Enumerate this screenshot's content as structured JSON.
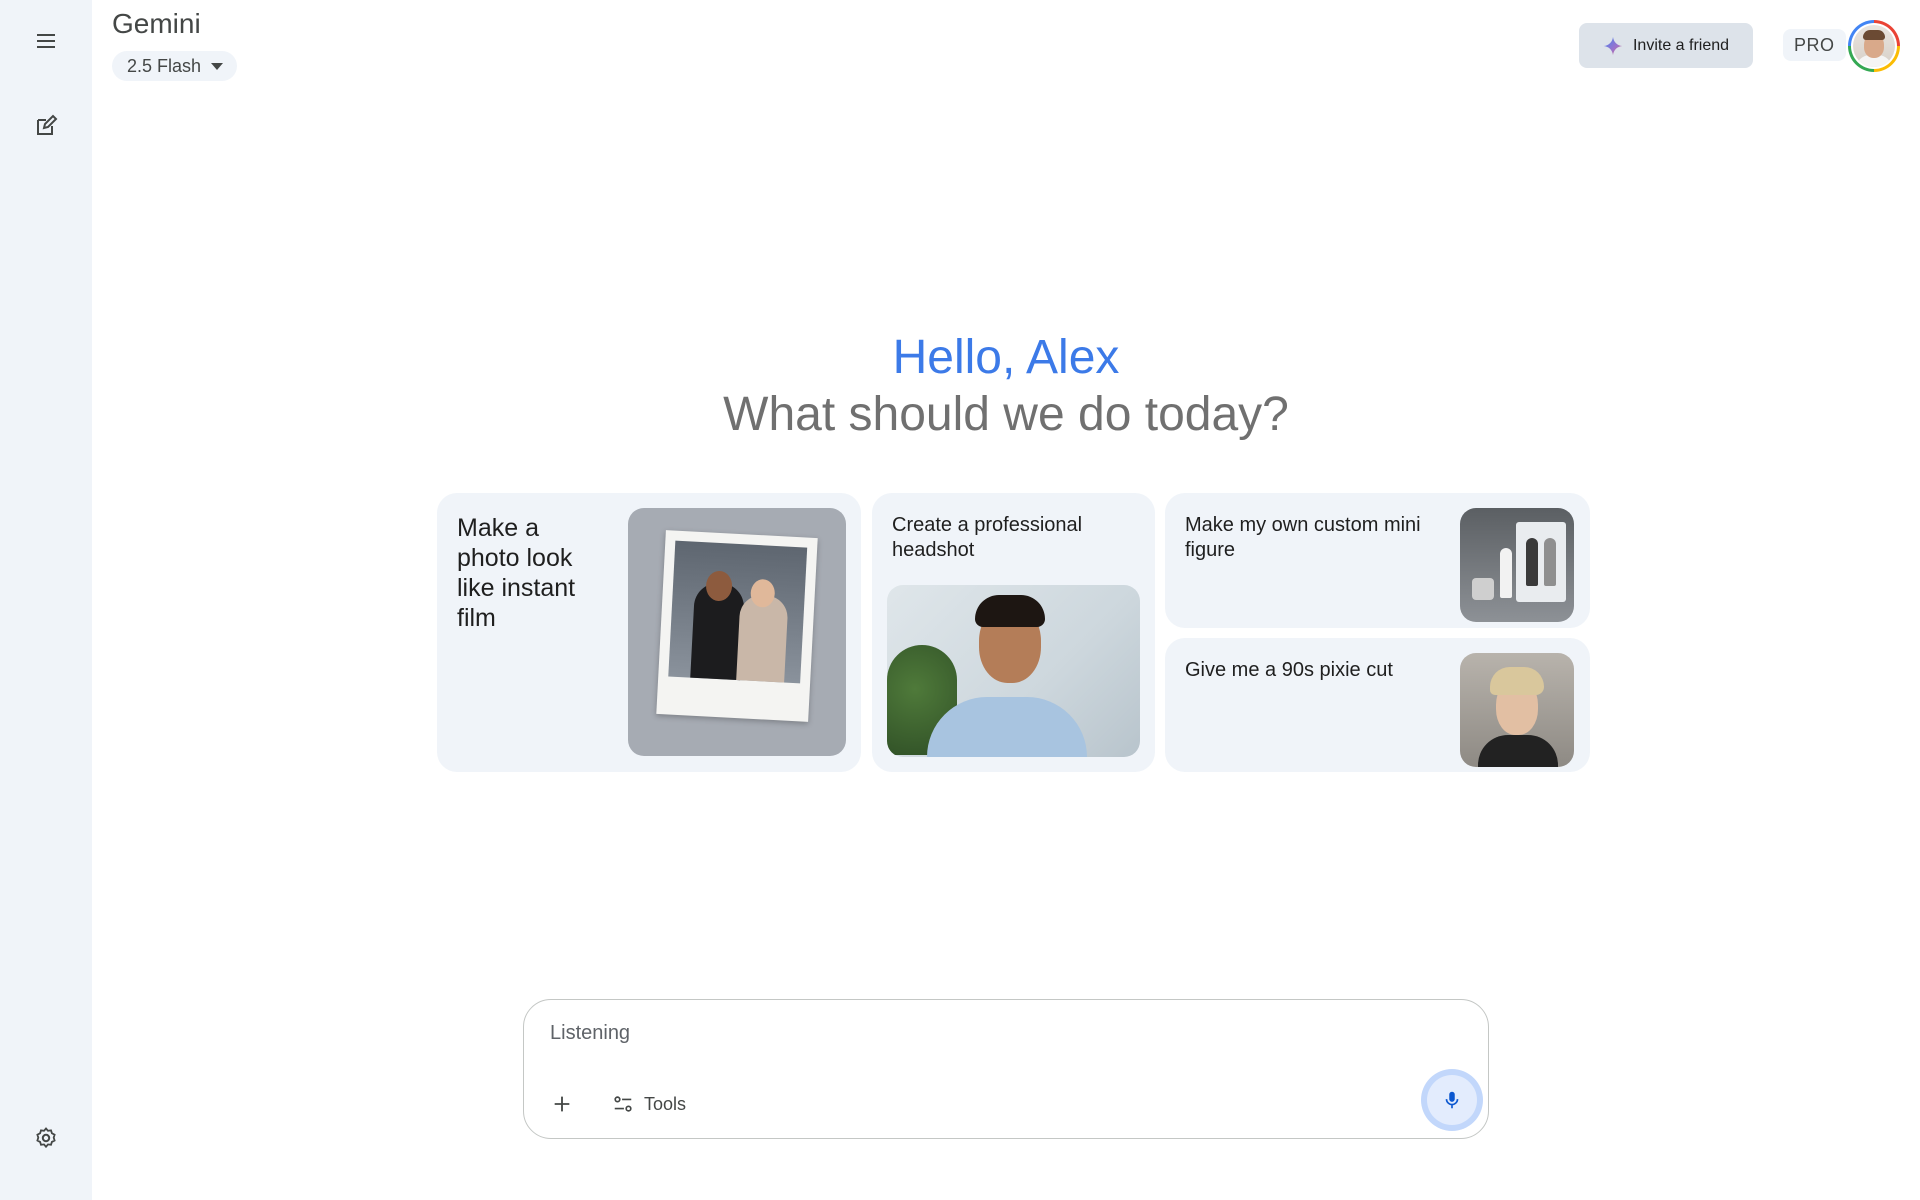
{
  "app": {
    "title": "Gemini",
    "model_label": "2.5 Flash"
  },
  "header": {
    "invite_label": "Invite a friend",
    "plan_badge": "PRO"
  },
  "rail": {
    "icons": [
      "menu-icon",
      "new-chat-icon",
      "settings-icon"
    ]
  },
  "greeting": {
    "hello": "Hello, Alex",
    "subtitle": "What should we do today?"
  },
  "cards": [
    {
      "label": "Make a photo look like instant film",
      "thumb": "polaroid-photo"
    },
    {
      "label": "Create a professional headshot",
      "thumb": "headshot-photo"
    },
    {
      "label": "Make my own custom mini figure",
      "thumb": "mini-figure-photo"
    },
    {
      "label": "Give me a 90s pixie cut",
      "thumb": "pixie-cut-photo"
    }
  ],
  "composer": {
    "placeholder": "Listening",
    "value": "",
    "tools_label": "Tools"
  },
  "colors": {
    "accent": "#3c7ae8",
    "rail_bg": "#f0f4f9",
    "card_bg": "#f0f4f9",
    "mic_active": "#c2d7fb"
  }
}
